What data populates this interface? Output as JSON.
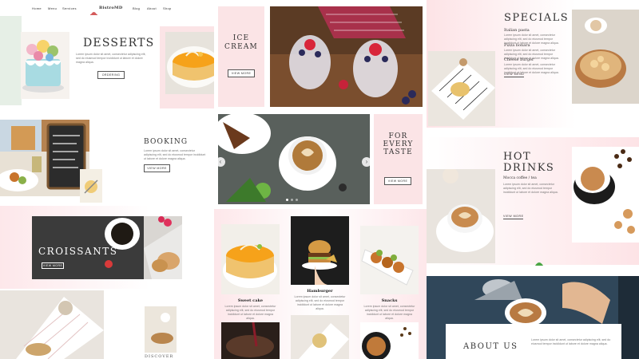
{
  "nav": {
    "brand": "BistroMD",
    "items": [
      "Home",
      "Menu",
      "Services",
      "Blog",
      "About",
      "Shop"
    ]
  },
  "sections": {
    "desserts": {
      "title": "DESSERTS",
      "button": "ORDERING"
    },
    "booking": {
      "title": "BOOKING",
      "button": "VIEW MORE"
    },
    "croissants": {
      "title": "CROISSANTS",
      "button": "VIEW MORE"
    },
    "ice_cream": {
      "title_line1": "ICE",
      "title_line2": "CREAM",
      "button": "VIEW MORE"
    },
    "every_taste": {
      "line1": "FOR",
      "line2": "EVERY",
      "line3": "TASTE",
      "button": "VIEW MORE"
    },
    "specials": {
      "title": "SPECIALS",
      "items": [
        "Italian pasta",
        "Pizza bonara",
        "Cheese burger"
      ],
      "button": "VIEW MENU"
    },
    "hot_drinks": {
      "line1": "HOT",
      "line2": "DRINKS",
      "subtitle": "Mocca coffee / tea",
      "button": "VIEW MORE"
    },
    "about": {
      "title": "ABOUT US"
    },
    "bottom_left": {
      "caption": "DISCOVER"
    }
  },
  "products": [
    {
      "name": "Sweet cake"
    },
    {
      "name": "Hamburger"
    },
    {
      "name": "Snacks"
    }
  ],
  "lorem": "Lorem ipsum dolor sit amet, consectetur adipiscing elit, sed do eiusmod tempor incididunt ut labore et dolore magna aliqua.",
  "colors": {
    "pink": "#fbe4e6",
    "accent": "#e9a2ad",
    "mint": "#e6efe6"
  },
  "icons": {
    "slider_prev": "chevron-left-icon",
    "slider_next": "chevron-right-icon"
  }
}
